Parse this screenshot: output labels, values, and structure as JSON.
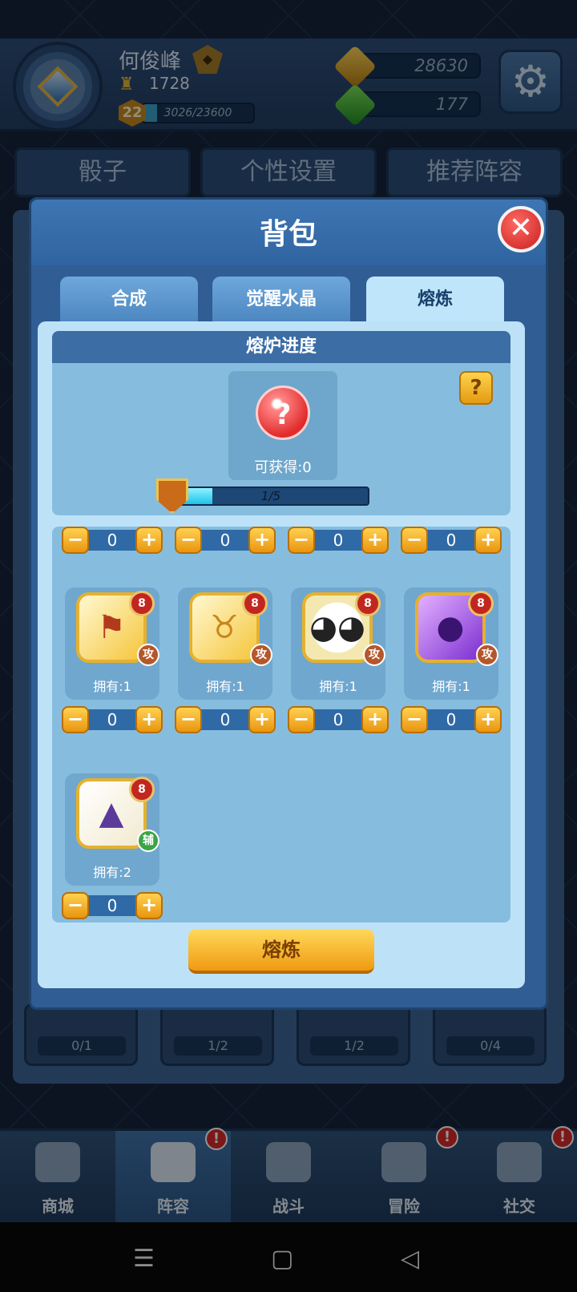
{
  "header": {
    "player_name": "何俊峰",
    "trophies": "1728",
    "level": "22",
    "xp_text": "3026/23600",
    "xp_progress": 0.128,
    "gold": "28630",
    "gems": "177"
  },
  "bg_tabs": [
    "骰子",
    "个性设置",
    "推荐阵容"
  ],
  "bg_slots": [
    "0/1",
    "1/2",
    "1/2",
    "0/4"
  ],
  "modal": {
    "title": "背包",
    "tabs": [
      "合成",
      "觉醒水晶",
      "熔炼"
    ],
    "active_tab": 2,
    "furnace": {
      "heading": "熔炉进度",
      "obtainable": "可获得:0",
      "progress_text": "1/5",
      "progress": 0.2
    },
    "top_steppers": [
      "0",
      "0",
      "0",
      "0"
    ],
    "items": [
      {
        "icon": "banner-icon",
        "level": "8",
        "tag": "攻",
        "owned": "拥有:1",
        "count": "0"
      },
      {
        "icon": "bull-icon",
        "level": "8",
        "tag": "攻",
        "owned": "拥有:1",
        "count": "0"
      },
      {
        "icon": "panda-icon",
        "level": "8",
        "tag": "攻",
        "owned": "拥有:1",
        "count": "0"
      },
      {
        "icon": "purple-face-icon",
        "level": "8",
        "tag": "攻",
        "owned": "拥有:1",
        "count": "0"
      },
      {
        "icon": "wizard-hat-icon",
        "level": "8",
        "tag": "辅",
        "owned": "拥有:2",
        "count": "0"
      }
    ],
    "smelt_button": "熔炼"
  },
  "nav": [
    {
      "label": "商城",
      "icon": "shop-icon"
    },
    {
      "label": "阵容",
      "icon": "dice-icon",
      "badge": "!"
    },
    {
      "label": "战斗",
      "icon": "swords-icon"
    },
    {
      "label": "冒险",
      "icon": "planet-icon",
      "badge": "!"
    },
    {
      "label": "社交",
      "icon": "chat-icon",
      "badge": "!"
    }
  ],
  "system": {
    "menu": "☰",
    "home": "▢",
    "back": "◁"
  }
}
